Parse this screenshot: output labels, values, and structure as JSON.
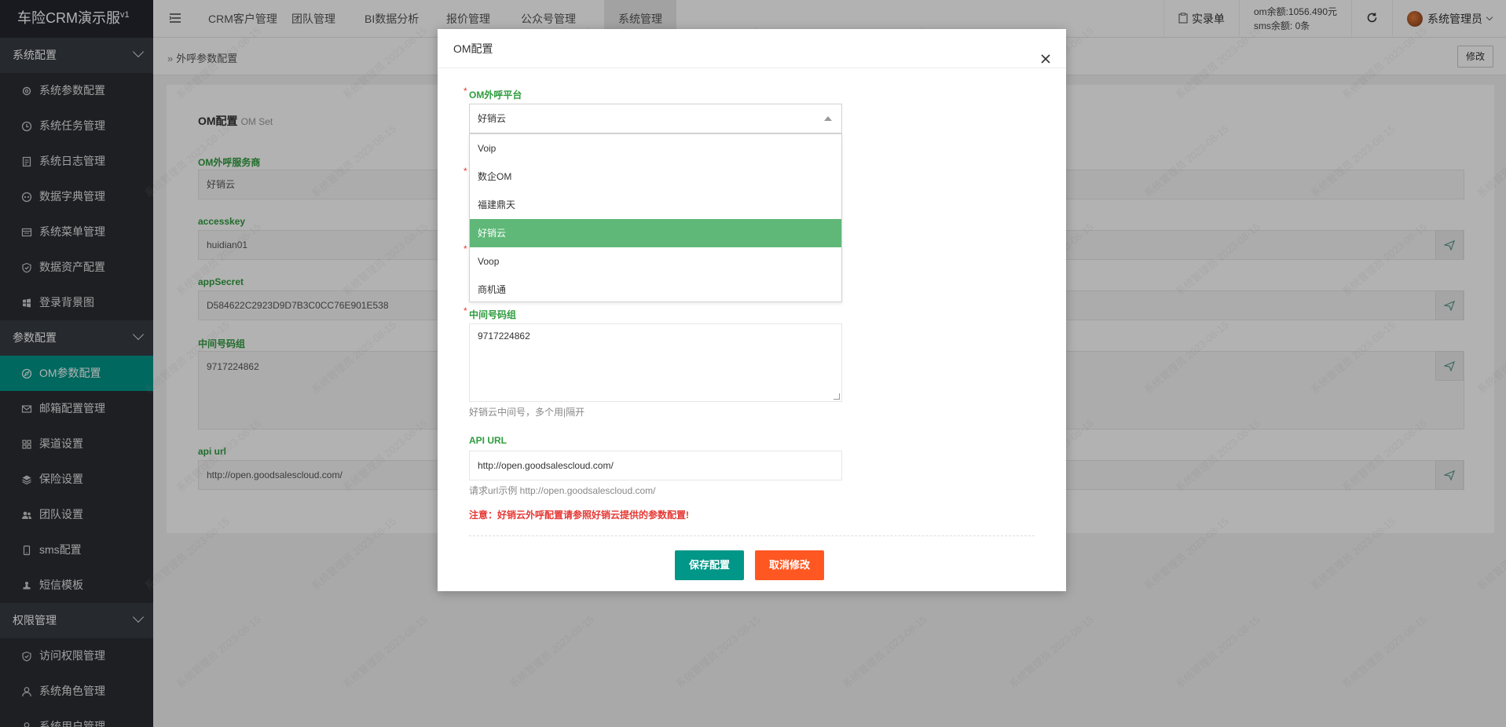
{
  "app": {
    "name": "车险CRM演示服",
    "version": "v1"
  },
  "sidebar": {
    "groups": [
      {
        "title": "系统配置",
        "items": [
          {
            "label": "系统参数配置",
            "icon": "gear-icon"
          },
          {
            "label": "系统任务管理",
            "icon": "clock-icon"
          },
          {
            "label": "系统日志管理",
            "icon": "log-icon"
          },
          {
            "label": "数据字典管理",
            "icon": "dictionary-icon"
          },
          {
            "label": "系统菜单管理",
            "icon": "menu-icon"
          },
          {
            "label": "数据资产配置",
            "icon": "shield-icon"
          },
          {
            "label": "登录背景图",
            "icon": "windows-icon"
          }
        ]
      },
      {
        "title": "参数配置",
        "items": [
          {
            "label": "OM参数配置",
            "icon": "compass-icon",
            "active": true
          },
          {
            "label": "邮箱配置管理",
            "icon": "mail-icon"
          },
          {
            "label": "渠道设置",
            "icon": "grid-icon"
          },
          {
            "label": "保险设置",
            "icon": "layers-icon"
          },
          {
            "label": "团队设置",
            "icon": "team-icon"
          },
          {
            "label": "sms配置",
            "icon": "phone-icon"
          },
          {
            "label": "短信模板",
            "icon": "stamp-icon"
          }
        ]
      },
      {
        "title": "权限管理",
        "items": [
          {
            "label": "访问权限管理",
            "icon": "shield-icon"
          },
          {
            "label": "系统角色管理",
            "icon": "user-icon"
          },
          {
            "label": "系统用户管理",
            "icon": "user-icon"
          }
        ]
      }
    ]
  },
  "topnav": {
    "tabs": [
      "CRM客户管理",
      "团队管理",
      "BI数据分析",
      "报价管理",
      "公众号管理",
      "系统管理"
    ],
    "active_tab": "系统管理",
    "record_label": "实录单",
    "om_balance": "om余额:1056.490元",
    "sms_balance": "sms余额: 0条",
    "user_name": "系统管理员"
  },
  "breadcrumb": {
    "label": "外呼参数配置",
    "edit_button": "修改"
  },
  "page": {
    "title": "OM配置",
    "subtitle": "OM Set",
    "fields": [
      {
        "label": "OM外呼服务商",
        "value": "好销云"
      },
      {
        "label": "accesskey",
        "value": "huidian01"
      },
      {
        "label": "appSecret",
        "value": "D584622C2923D9D7B3C0CC76E901E538"
      },
      {
        "label": "中间号码组",
        "value": "9717224862"
      },
      {
        "label": "api url",
        "value": "http://open.goodsalescloud.com/"
      }
    ]
  },
  "modal": {
    "title": "OM配置",
    "platform_label": "OM外呼平台",
    "platform_value": "好销云",
    "platform_options": [
      "Voip",
      "数企OM",
      "福建鼎天",
      "好销云",
      "Voop",
      "商机通"
    ],
    "platform_selected": "好销云",
    "number_group_label": "中间号码组",
    "number_group_value": "9717224862",
    "number_group_help": "好销云中间号，多个用|隔开",
    "api_label": "API URL",
    "api_value": "http://open.goodsalescloud.com/",
    "api_help": "请求url示例 http://open.goodsalescloud.com/",
    "warning": "注意：好销云外呼配置请参照好销云提供的参数配置!",
    "save_button": "保存配置",
    "cancel_button": "取消修改"
  },
  "watermark": "系统管理员 2023-08-15",
  "colors": {
    "accent": "#009688",
    "label_green": "#2e9c3e",
    "danger": "#ff5722",
    "selected_option": "#5fb878"
  }
}
